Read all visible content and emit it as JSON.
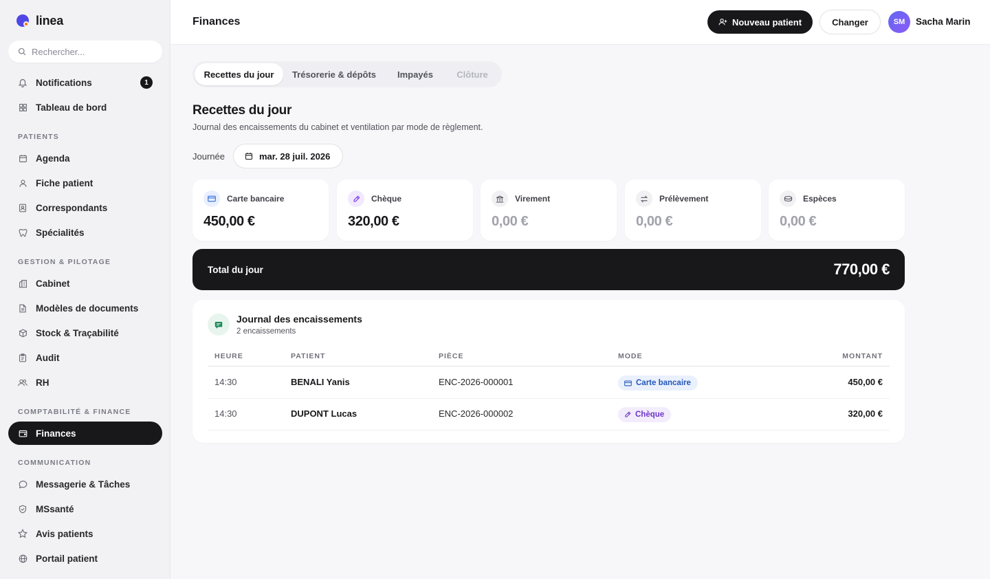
{
  "app": {
    "name": "linea"
  },
  "search": {
    "placeholder": "Rechercher..."
  },
  "sidebar": {
    "top_items": [
      {
        "label": "Notifications",
        "icon": "bell-icon",
        "badge": "1"
      },
      {
        "label": "Tableau de bord",
        "icon": "grid-icon"
      }
    ],
    "sections": [
      {
        "title": "PATIENTS",
        "items": [
          {
            "label": "Agenda",
            "icon": "calendar-icon"
          },
          {
            "label": "Fiche patient",
            "icon": "user-icon"
          },
          {
            "label": "Correspondants",
            "icon": "contact-card-icon"
          },
          {
            "label": "Spécialités",
            "icon": "tooth-icon"
          }
        ]
      },
      {
        "title": "GESTION & PILOTAGE",
        "items": [
          {
            "label": "Cabinet",
            "icon": "building-icon"
          },
          {
            "label": "Modèles de documents",
            "icon": "document-icon"
          },
          {
            "label": "Stock & Traçabilité",
            "icon": "box-icon"
          },
          {
            "label": "Audit",
            "icon": "clipboard-icon"
          },
          {
            "label": "RH",
            "icon": "users-icon"
          }
        ]
      },
      {
        "title": "COMPTABILITÉ & FINANCE",
        "items": [
          {
            "label": "Finances",
            "icon": "wallet-icon",
            "active": true
          }
        ]
      },
      {
        "title": "COMMUNICATION",
        "items": [
          {
            "label": "Messagerie & Tâches",
            "icon": "chat-icon"
          },
          {
            "label": "MSsanté",
            "icon": "shield-icon"
          },
          {
            "label": "Avis patients",
            "icon": "star-icon"
          },
          {
            "label": "Portail patient",
            "icon": "globe-icon"
          }
        ]
      }
    ]
  },
  "header": {
    "title": "Finances",
    "new_patient_label": "Nouveau patient",
    "change_label": "Changer",
    "user_initials": "SM",
    "user_name": "Sacha Marin"
  },
  "tabs": [
    {
      "label": "Recettes du jour",
      "state": "active"
    },
    {
      "label": "Trésorerie & dépôts",
      "state": "normal"
    },
    {
      "label": "Impayés",
      "state": "normal"
    },
    {
      "label": "Clôture",
      "state": "disabled"
    }
  ],
  "main": {
    "title": "Recettes du jour",
    "subtitle": "Journal des encaissements du cabinet et ventilation par mode de règlement.",
    "date_label": "Journée",
    "date_value": "mar. 28 juil. 2026"
  },
  "cards": [
    {
      "label": "Carte bancaire",
      "value": "450,00 €",
      "icon": "credit-card-icon",
      "muted": false,
      "icon_bg": "#e8efff",
      "icon_color": "#2f6bd8"
    },
    {
      "label": "Chèque",
      "value": "320,00 €",
      "icon": "pen-icon",
      "muted": false,
      "icon_bg": "#f1e9fd",
      "icon_color": "#7c3aed"
    },
    {
      "label": "Virement",
      "value": "0,00 €",
      "icon": "bank-icon",
      "muted": true,
      "icon_bg": "#f1f1f4",
      "icon_color": "#52525b"
    },
    {
      "label": "Prélèvement",
      "value": "0,00 €",
      "icon": "transfer-arrows-icon",
      "muted": true,
      "icon_bg": "#f1f1f4",
      "icon_color": "#52525b"
    },
    {
      "label": "Espèces",
      "value": "0,00 €",
      "icon": "cash-icon",
      "muted": true,
      "icon_bg": "#f1f1f4",
      "icon_color": "#52525b"
    }
  ],
  "total": {
    "label": "Total du jour",
    "value": "770,00 €"
  },
  "journal": {
    "title": "Journal des encaissements",
    "subtitle": "2 encaissements",
    "columns": [
      "HEURE",
      "PATIENT",
      "PIÈCE",
      "MODE",
      "MONTANT"
    ],
    "rows": [
      {
        "time": "14:30",
        "patient": "BENALI Yanis",
        "piece": "ENC-2026-000001",
        "mode": "Carte bancaire",
        "mode_icon": "credit-card-icon",
        "amount": "450,00 €"
      },
      {
        "time": "14:30",
        "patient": "DUPONT Lucas",
        "piece": "ENC-2026-000002",
        "mode": "Chèque",
        "mode_icon": "pen-icon",
        "amount": "320,00 €"
      }
    ]
  },
  "colors": {
    "accent_dark": "#18181b",
    "brand_blue": "#4f46e5",
    "brand_orange": "#f97316"
  }
}
